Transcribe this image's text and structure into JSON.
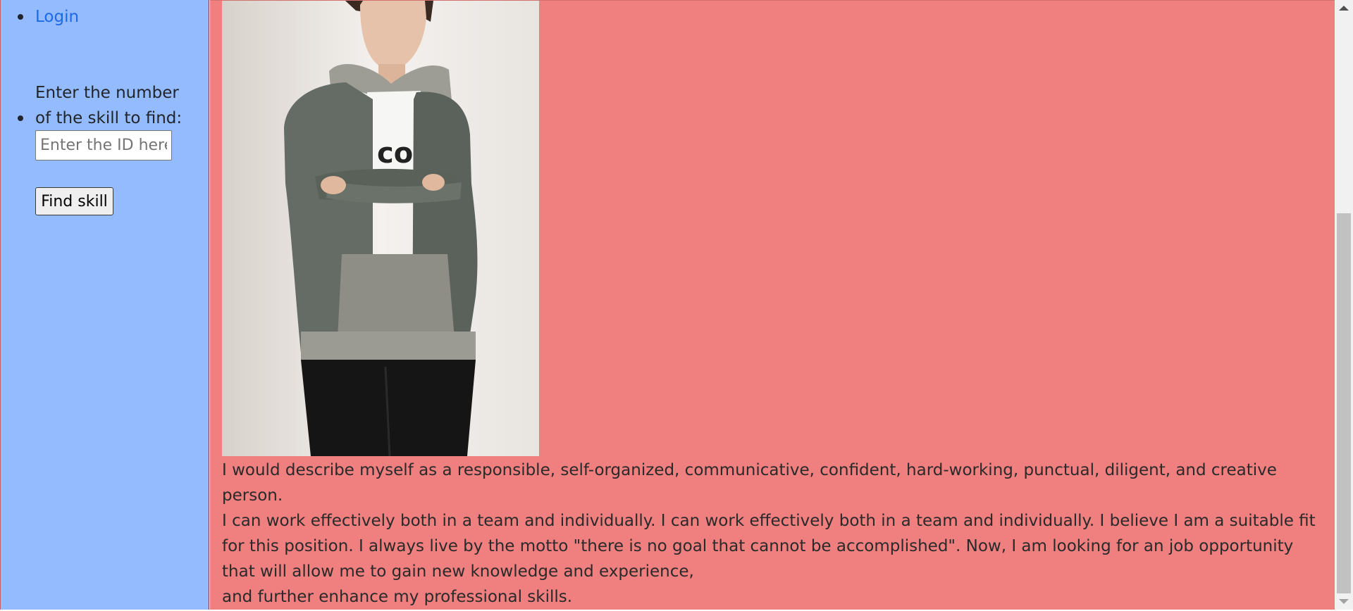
{
  "sidebar": {
    "login_label": "Login",
    "find_label": "Enter the number of the skill to find:",
    "id_placeholder": "Enter the ID here",
    "find_button_label": "Find skill"
  },
  "profile": {
    "photo_icon": "person-photo-icon",
    "bio_paragraphs": [
      "I would describe myself as a responsible, self-organized, communicative, confident, hard-working, punctual, diligent, and creative person.",
      "I can work effectively both in a team and individually. I can work effectively both in a team and individually. I believe I am a suitable fit for this position. I always live by the motto \"there is no goal that cannot be accomplished\". Now, I am looking for an job opportunity that will allow me to gain new knowledge and experience,",
      "and further enhance my professional skills."
    ]
  },
  "colors": {
    "sidebar_bg": "#94bbfe",
    "main_bg": "#f07f7f",
    "link": "#1d6ae5"
  }
}
